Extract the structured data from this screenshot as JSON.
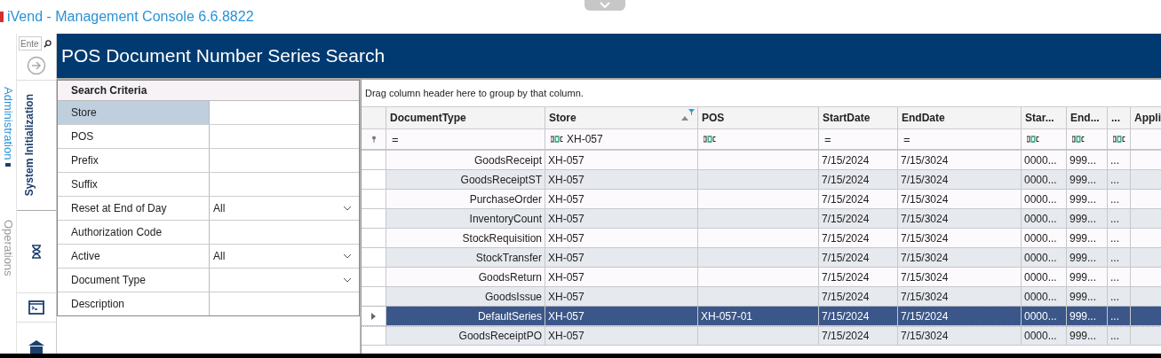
{
  "window": {
    "title": "iVend - Management Console  6.6.8822"
  },
  "outer_nav": [
    {
      "label": "Administration",
      "selected": true
    },
    {
      "label": "Operations",
      "selected": false
    }
  ],
  "nav": {
    "search": {
      "placeholder": "Ente"
    },
    "tab": {
      "label": "System Initialization"
    }
  },
  "page_title": "POS Document Number Series Search",
  "search_criteria": {
    "title": "Search Criteria",
    "fields": [
      {
        "label": "Store",
        "kind": "text",
        "selected": true
      },
      {
        "label": "POS",
        "kind": "text",
        "selected": false
      },
      {
        "label": "Prefix",
        "kind": "text",
        "selected": false
      },
      {
        "label": "Suffix",
        "kind": "text",
        "selected": false
      },
      {
        "label": "Reset at End of Day",
        "kind": "dropdown",
        "value": "All",
        "selected": false
      },
      {
        "label": "Authorization Code",
        "kind": "text",
        "selected": false
      },
      {
        "label": "Active",
        "kind": "dropdown",
        "value": "All",
        "selected": false
      },
      {
        "label": "Document Type",
        "kind": "dropdown",
        "selected": false
      },
      {
        "label": "Description",
        "kind": "text",
        "selected": false
      }
    ]
  },
  "grid": {
    "group_hint": "Drag column header here to group by that column.",
    "columns": [
      {
        "label": "DocumentType",
        "filter": {
          "kind": "operator",
          "text": "="
        }
      },
      {
        "label": "Store",
        "sorted": true,
        "filtered": true,
        "filter": {
          "kind": "text",
          "value": "XH-057"
        }
      },
      {
        "label": "POS",
        "filter": {
          "kind": "text"
        }
      },
      {
        "label": "StartDate",
        "filter": {
          "kind": "operator",
          "text": "="
        }
      },
      {
        "label": "EndDate",
        "filter": {
          "kind": "operator",
          "text": "="
        }
      },
      {
        "label": "Star...",
        "filter": {
          "kind": "text"
        }
      },
      {
        "label": "End...",
        "filter": {
          "kind": "text"
        }
      },
      {
        "label": "...",
        "filter": {
          "kind": "text"
        }
      },
      {
        "label": "Appli",
        "filter": {
          "kind": "none"
        }
      }
    ],
    "rows": [
      {
        "selected": false,
        "cells": [
          "GoodsReceipt",
          "XH-057",
          "",
          "7/15/2024",
          "7/15/3024",
          "0000...",
          "999...",
          "...",
          ""
        ]
      },
      {
        "selected": false,
        "cells": [
          "GoodsReceiptST",
          "XH-057",
          "",
          "7/15/2024",
          "7/15/3024",
          "0000...",
          "999...",
          "...",
          ""
        ]
      },
      {
        "selected": false,
        "cells": [
          "PurchaseOrder",
          "XH-057",
          "",
          "7/15/2024",
          "7/15/3024",
          "0000...",
          "999...",
          "...",
          ""
        ]
      },
      {
        "selected": false,
        "cells": [
          "InventoryCount",
          "XH-057",
          "",
          "7/15/2024",
          "7/15/3024",
          "0000...",
          "999...",
          "...",
          ""
        ]
      },
      {
        "selected": false,
        "cells": [
          "StockRequisition",
          "XH-057",
          "",
          "7/15/2024",
          "7/15/3024",
          "0000...",
          "999...",
          "...",
          ""
        ]
      },
      {
        "selected": false,
        "cells": [
          "StockTransfer",
          "XH-057",
          "",
          "7/15/2024",
          "7/15/3024",
          "0000...",
          "999...",
          "...",
          ""
        ]
      },
      {
        "selected": false,
        "cells": [
          "GoodsReturn",
          "XH-057",
          "",
          "7/15/2024",
          "7/15/3024",
          "0000...",
          "999...",
          "...",
          ""
        ]
      },
      {
        "selected": false,
        "cells": [
          "GoodsIssue",
          "XH-057",
          "",
          "7/15/2024",
          "7/15/3024",
          "0000...",
          "999...",
          "...",
          ""
        ]
      },
      {
        "selected": true,
        "cells": [
          "DefaultSeries",
          "XH-057",
          "XH-057-01",
          "7/15/2024",
          "7/15/2024",
          "0000...",
          "999...",
          "...",
          ""
        ]
      },
      {
        "selected": false,
        "cells": [
          "GoodsReceiptPO",
          "XH-057",
          "",
          "7/15/2024",
          "7/15/3024",
          "0000...",
          "999...",
          "...",
          ""
        ]
      }
    ]
  }
}
